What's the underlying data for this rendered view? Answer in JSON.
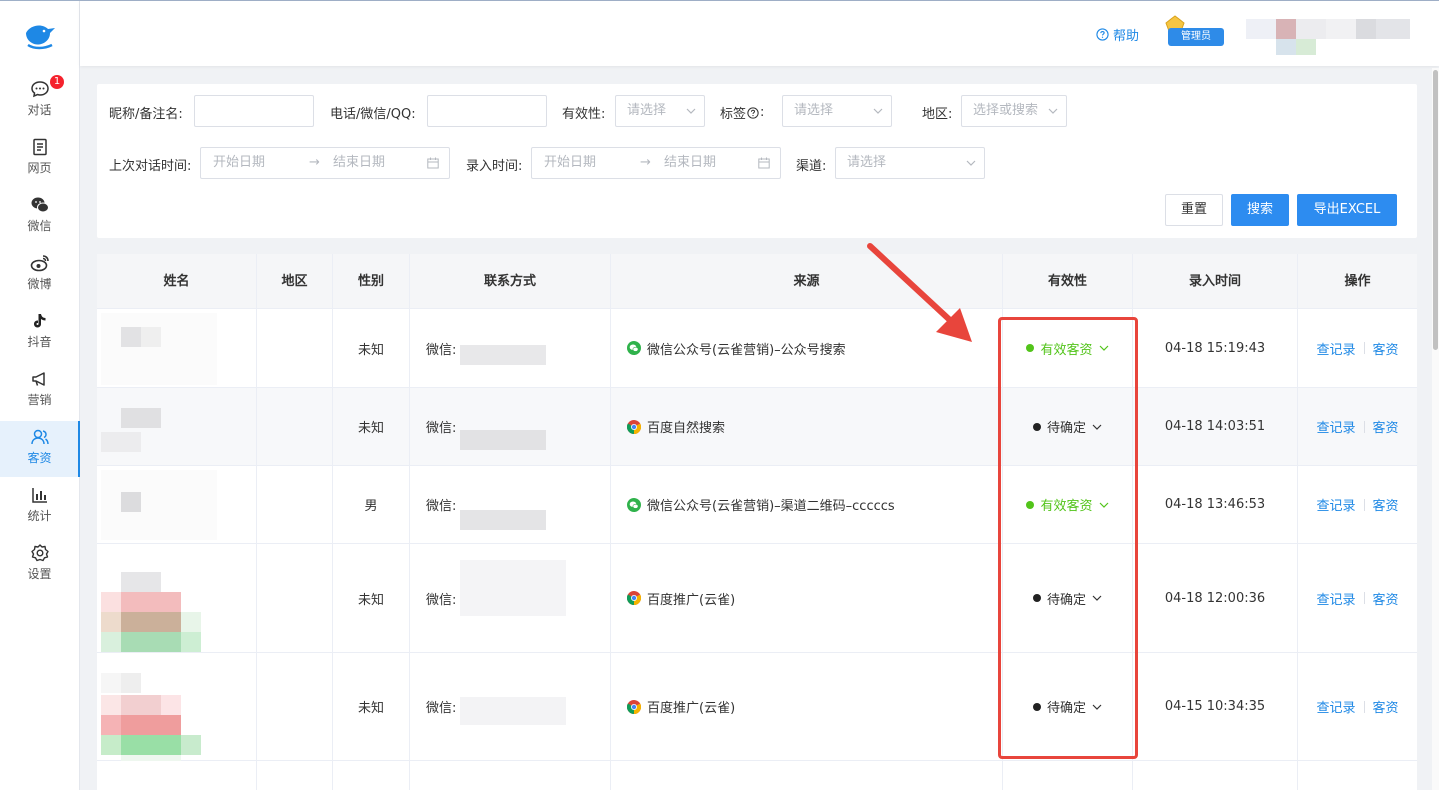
{
  "header": {
    "help_label": "帮助",
    "admin_label": "管理员"
  },
  "sidebar": {
    "items": [
      {
        "label": "对话",
        "icon": "chat-icon",
        "badge": "1"
      },
      {
        "label": "网页",
        "icon": "webpage-icon"
      },
      {
        "label": "微信",
        "icon": "wechat-icon"
      },
      {
        "label": "微博",
        "icon": "weibo-icon"
      },
      {
        "label": "抖音",
        "icon": "douyin-icon"
      },
      {
        "label": "营销",
        "icon": "megaphone-icon"
      },
      {
        "label": "客资",
        "icon": "customers-icon",
        "active": true
      },
      {
        "label": "统计",
        "icon": "stats-icon"
      },
      {
        "label": "设置",
        "icon": "gear-icon"
      }
    ]
  },
  "filters": {
    "nickname_label": "昵称/备注名:",
    "phone_label": "电话/微信/QQ:",
    "validity_label": "有效性:",
    "validity_placeholder": "请选择",
    "tag_label": "标签",
    "tag_suffix": ":",
    "tag_placeholder": "请选择",
    "region_label": "地区:",
    "region_placeholder": "选择或搜索",
    "last_chat_label": "上次对话时间:",
    "start_date": "开始日期",
    "end_date": "结束日期",
    "arrow": "→",
    "entry_time_label": "录入时间:",
    "channel_label": "渠道:",
    "channel_placeholder": "请选择",
    "reset_label": "重置",
    "search_label": "搜索",
    "export_label": "导出EXCEL"
  },
  "table": {
    "columns": [
      "姓名",
      "地区",
      "性别",
      "联系方式",
      "来源",
      "有效性",
      "录入时间",
      "操作"
    ],
    "rows": [
      {
        "gender": "未知",
        "contact_prefix": "微信:",
        "source": "微信公众号(云雀营销)–公众号搜索",
        "source_icon": "wechat-icon",
        "status": "有效客资",
        "status_type": "valid",
        "time": "04-18 15:19:43"
      },
      {
        "gender": "未知",
        "contact_prefix": "微信:",
        "source": "百度自然搜索",
        "source_icon": "chrome-icon",
        "status": "待确定",
        "status_type": "pending",
        "time": "04-18 14:03:51"
      },
      {
        "gender": "男",
        "contact_prefix": "微信:",
        "source": "微信公众号(云雀营销)–渠道二维码–cccccs",
        "source_icon": "wechat-icon",
        "status": "有效客资",
        "status_type": "valid",
        "time": "04-18 13:46:53"
      },
      {
        "gender": "未知",
        "contact_prefix": "微信:",
        "source": "百度推广(云雀)",
        "source_icon": "chrome-icon",
        "status": "待确定",
        "status_type": "pending",
        "time": "04-18 12:00:36"
      },
      {
        "gender": "未知",
        "contact_prefix": "微信:",
        "source": "百度推广(云雀)",
        "source_icon": "chrome-icon",
        "status": "待确定",
        "status_type": "pending",
        "time": "04-15 10:34:35"
      }
    ],
    "action_view": "查记录",
    "action_detail": "客资"
  },
  "colors": {
    "accent": "#1e88e5",
    "primary_button": "#2d8cf0",
    "valid": "#52c41a",
    "annotation": "#e8453c"
  }
}
